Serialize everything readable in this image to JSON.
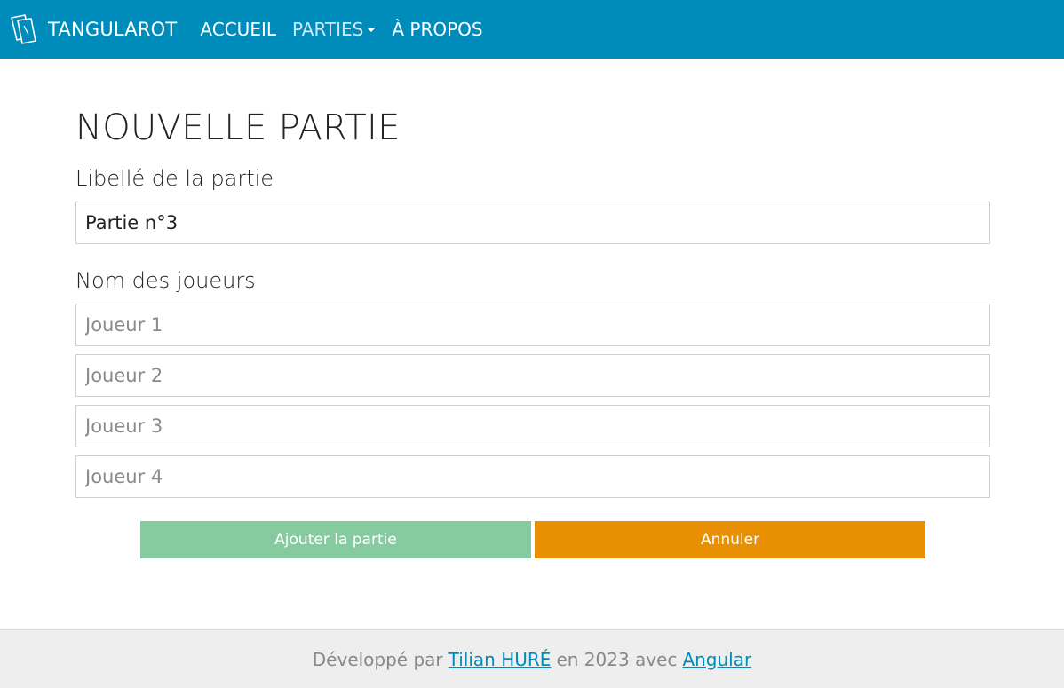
{
  "navbar": {
    "brand_icon": "cards-icon",
    "brand": "TANGULAROT",
    "links": {
      "home": "ACCUEIL",
      "games": "PARTIES",
      "about": "À PROPOS"
    },
    "colors": {
      "background": "#008cba",
      "text": "#ffffff"
    }
  },
  "page": {
    "title": "NOUVELLE PARTIE",
    "game_label": "Libellé de la partie",
    "game_name_value": "Partie n°3",
    "players_label": "Nom des joueurs",
    "players": [
      {
        "placeholder": "Joueur 1",
        "value": ""
      },
      {
        "placeholder": "Joueur 2",
        "value": ""
      },
      {
        "placeholder": "Joueur 3",
        "value": ""
      },
      {
        "placeholder": "Joueur 4",
        "value": ""
      }
    ]
  },
  "actions": {
    "add_label": "Ajouter la partie",
    "cancel_label": "Annuler",
    "colors": {
      "add": "#86cb9f",
      "cancel": "#e99002"
    }
  },
  "footer": {
    "prefix": "Développé par",
    "author": "Tilian HURÉ",
    "middle": "en 2023 avec",
    "framework": "Angular",
    "link_color": "#008cba"
  }
}
